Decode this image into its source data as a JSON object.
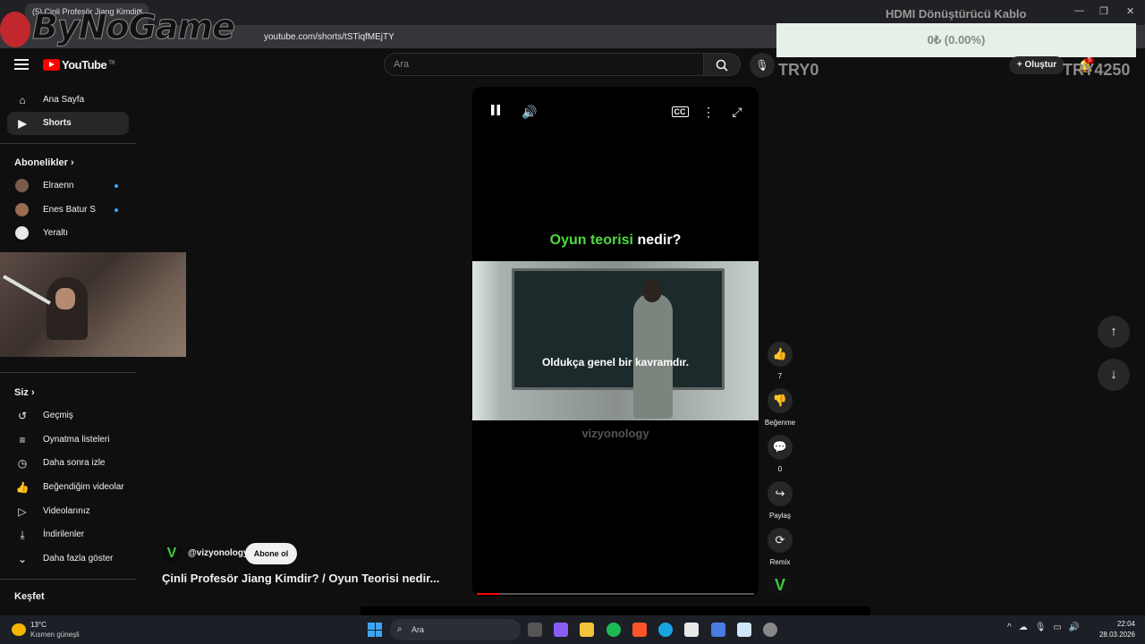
{
  "browser": {
    "tab_title": "(5) Çinli Profesör Jiang Kimdir",
    "tab_close": "×",
    "url": "youtube.com/shorts/tSTiqfMEjTY",
    "window_title": "HDMI Dönüştürücü Kablo",
    "window_buttons": [
      "—",
      "❐",
      "✕"
    ]
  },
  "overlay": {
    "logo_text": "ByNoGame",
    "price": "0₺ (0.00%)",
    "try0": "TRY0",
    "try4250": "TRY4250"
  },
  "header": {
    "logo": "YouTube",
    "region": "TR",
    "search_placeholder": "Ara",
    "create_label": "Oluştur",
    "notification_count": "5"
  },
  "sidebar": {
    "main": [
      {
        "label": "Ana Sayfa",
        "icon": "home-icon"
      },
      {
        "label": "Shorts",
        "icon": "shorts-icon",
        "active": true
      }
    ],
    "subscriptions_heading": "Abonelikler",
    "subscriptions": [
      {
        "label": "Elraenn",
        "new": true
      },
      {
        "label": "Enes Batur S",
        "new": true
      },
      {
        "label": "Yeraltı",
        "new": false
      }
    ],
    "you_heading": "Siz",
    "you": [
      {
        "label": "Geçmiş",
        "icon": "history-icon"
      },
      {
        "label": "Oynatma listeleri",
        "icon": "playlists-icon"
      },
      {
        "label": "Daha sonra izle",
        "icon": "watch-later-icon"
      },
      {
        "label": "Beğendiğim videolar",
        "icon": "liked-icon"
      },
      {
        "label": "Videolarınız",
        "icon": "your-videos-icon"
      },
      {
        "label": "İndirilenler",
        "icon": "downloads-icon"
      },
      {
        "label": "Daha fazla göster",
        "icon": "chevron-down-icon"
      }
    ],
    "explore_heading": "Keşfet"
  },
  "player": {
    "caption_highlight": "Oyun teorisi",
    "caption_rest": " nedir?",
    "subtitle": "Oldukça genel bir kavramdır.",
    "watermark": "vizyonology",
    "progress": 0.08
  },
  "actions": {
    "like_count": "7",
    "dislike_label": "Beğenme",
    "comment_count": "0",
    "share_label": "Paylaş",
    "remix_label": "Remix"
  },
  "video": {
    "channel": "@vizyonology",
    "subscribe_label": "Abone ol",
    "title": "Çinli Profesör Jiang Kimdir? / Oyun Teorisi nedir..."
  },
  "taskbar": {
    "temperature": "13°C",
    "weather": "Kısmen güneşli",
    "search_placeholder": "Ara",
    "time": "22:04",
    "date": "28.03.2026"
  },
  "colors": {
    "background": "#0f0f0f",
    "youtube_red": "#ff0000",
    "caption_green": "#4ddb3f",
    "subscription_dot": "#3ea6ff"
  }
}
